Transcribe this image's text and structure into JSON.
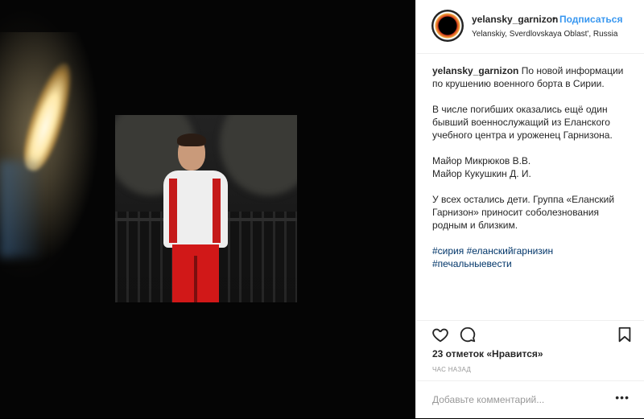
{
  "post_image": {
    "alt": ""
  },
  "header": {
    "username": "yelansky_garnizon",
    "separator": "•",
    "follow_label": "Подписаться",
    "location": "Yelanskiy, Sverdlovskaya Oblast', Russia"
  },
  "caption": {
    "username": "yelansky_garnizon",
    "line1": "По новой информации по крушению военного борта в Сирии.",
    "paragraph2": "В числе погибших оказались ещё один бывший военнослужащий из Еланского учебного центра и уроженец Гарнизона.",
    "name1": "Майор Микрюков В.В.",
    "name2": "Майор Кукушкин Д. И.",
    "paragraph4": "У всех остались дети. Группа «Еланский Гарнизон» приносит соболезнования родным и близким.",
    "hashtag1": "#сирия",
    "hashtag2": "#еланскийгарнизин",
    "hashtag3": "#печальныевести"
  },
  "actions": {
    "like_icon": "heart-icon",
    "comment_icon": "comment-icon",
    "save_icon": "bookmark-icon"
  },
  "likes_text": "23 отметок «Нравится»",
  "timestamp": "ЧАС НАЗАД",
  "comment": {
    "placeholder": "Добавьте комментарий...",
    "more_label": "•••"
  },
  "colors": {
    "link": "#3897f0",
    "hashtag": "#003569",
    "text": "#262626",
    "muted": "#999999"
  }
}
